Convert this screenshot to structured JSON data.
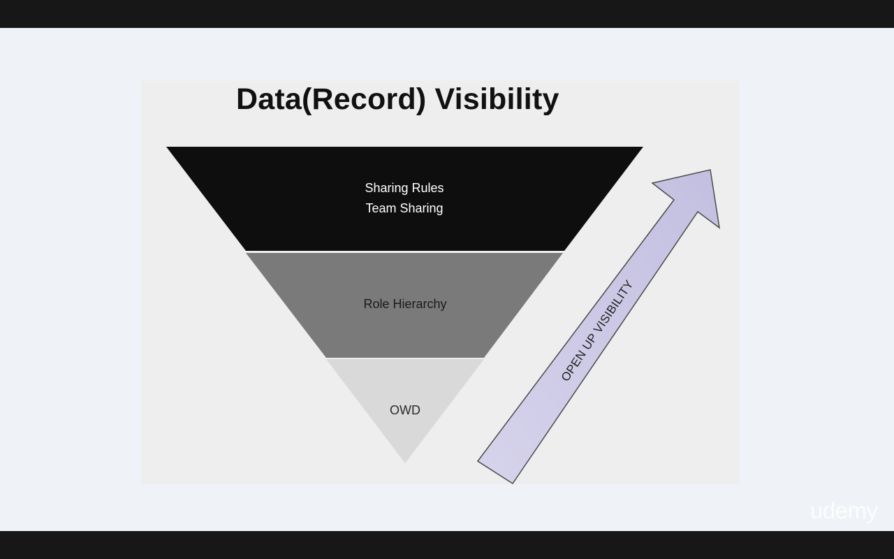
{
  "slide": {
    "title": "Data(Record) Visibility"
  },
  "pyramid": {
    "top_layer": {
      "line1": "Sharing Rules",
      "line2": "Team Sharing",
      "color": "#0e0e0e"
    },
    "middle_layer": {
      "label": "Role Hierarchy",
      "color": "#7a7a7a"
    },
    "bottom_layer": {
      "label": "OWD",
      "color": "#d9d9d9"
    }
  },
  "arrow": {
    "label": "OPEN UP VISIBILITY",
    "fill_color": "#ccc8e6"
  },
  "watermark": {
    "text": "udemy"
  }
}
